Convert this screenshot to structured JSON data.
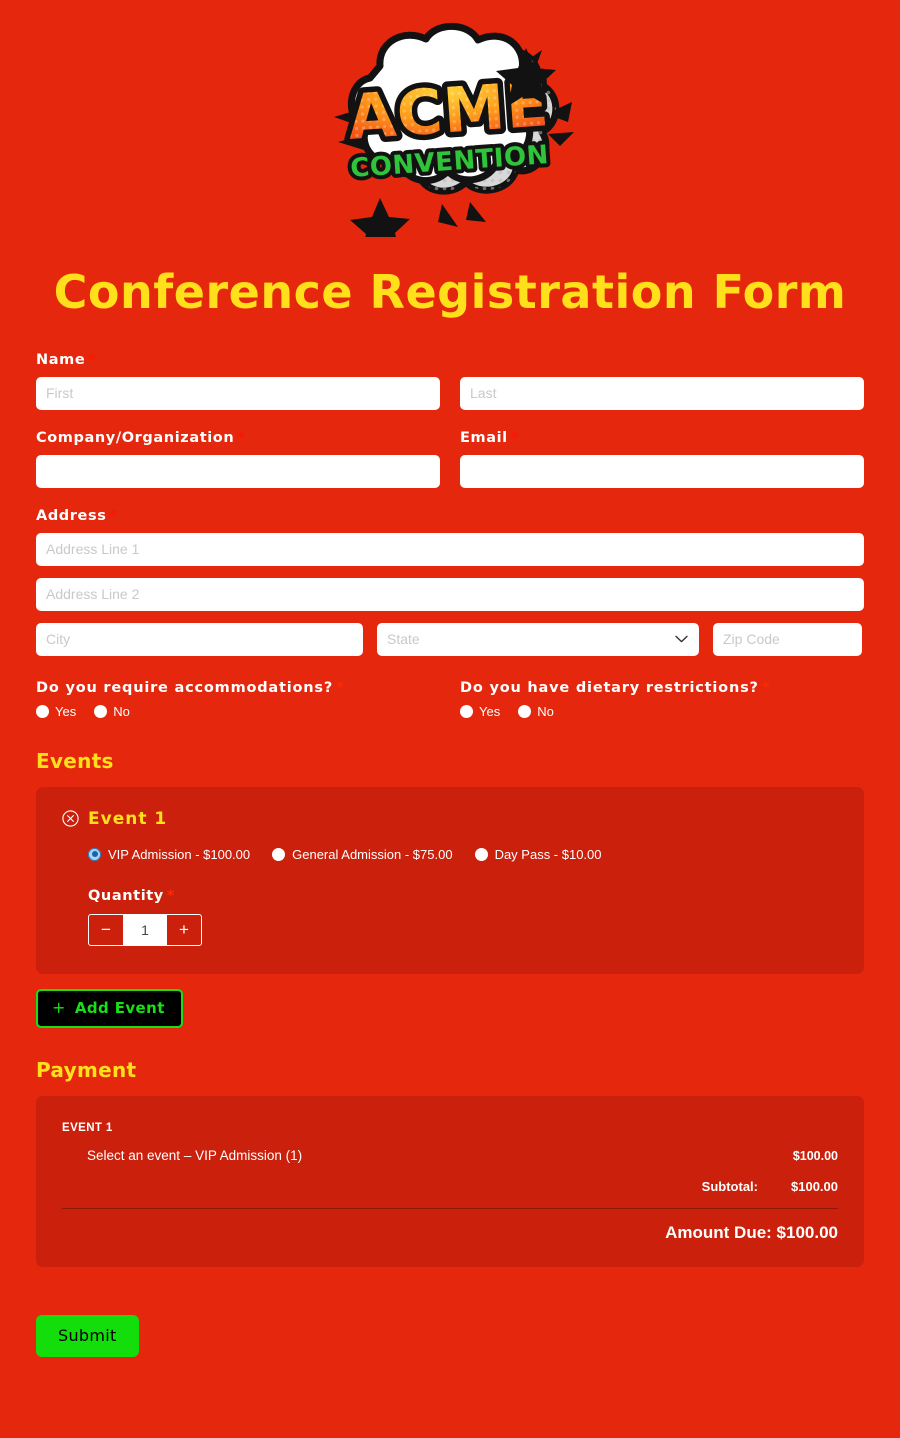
{
  "brand": {
    "logo_primary_text": "ACME",
    "logo_secondary_text": "CONVENTION",
    "accent_yellow": "#ffe01b",
    "page_red": "#e5270d",
    "card_red": "#cb200b",
    "green": "#19e016"
  },
  "header": {
    "title": "Conference Registration Form"
  },
  "form": {
    "name": {
      "label": "Name",
      "required_mark": "*",
      "first_placeholder": "First",
      "first_value": "",
      "last_placeholder": "Last",
      "last_value": ""
    },
    "company": {
      "label": "Company/Organization",
      "required_mark": "*",
      "placeholder": "",
      "value": ""
    },
    "email": {
      "label": "Email",
      "required_mark": "*",
      "placeholder": "",
      "value": ""
    },
    "address": {
      "label": "Address",
      "required_mark": "*",
      "line1_placeholder": "Address Line 1",
      "line1_value": "",
      "line2_placeholder": "Address Line 2",
      "line2_value": "",
      "city_placeholder": "City",
      "city_value": "",
      "state_placeholder": "State",
      "state_value": "",
      "zip_placeholder": "Zip Code",
      "zip_value": ""
    },
    "accommodations": {
      "label": "Do you require accommodations?",
      "required_mark": "*",
      "options": [
        {
          "label": "Yes",
          "selected": false
        },
        {
          "label": "No",
          "selected": false
        }
      ]
    },
    "dietary": {
      "label": "Do you have dietary restrictions?",
      "required_mark": "*",
      "options": [
        {
          "label": "Yes",
          "selected": false
        },
        {
          "label": "No",
          "selected": false
        }
      ]
    }
  },
  "events": {
    "heading": "Events",
    "event_1": {
      "title": "Event 1",
      "remove_icon": "circle-x-icon",
      "tickets": [
        {
          "label": "VIP Admission - $100.00",
          "selected": true
        },
        {
          "label": "General Admission - $75.00",
          "selected": false
        },
        {
          "label": "Day Pass - $10.00",
          "selected": false
        }
      ],
      "quantity": {
        "label": "Quantity",
        "required_mark": "*",
        "value": "1",
        "decrement_label": "−",
        "increment_label": "+"
      }
    },
    "add_event_label": "Add Event",
    "add_event_icon": "plus-icon"
  },
  "payment": {
    "heading": "Payment",
    "event_label": "EVENT 1",
    "line_items": [
      {
        "description": "Select an event – VIP Admission (1)",
        "amount": "$100.00"
      }
    ],
    "subtotal_label": "Subtotal:",
    "subtotal_amount": "$100.00",
    "amount_due_text": "Amount Due: $100.00"
  },
  "submit": {
    "label": "Submit"
  }
}
